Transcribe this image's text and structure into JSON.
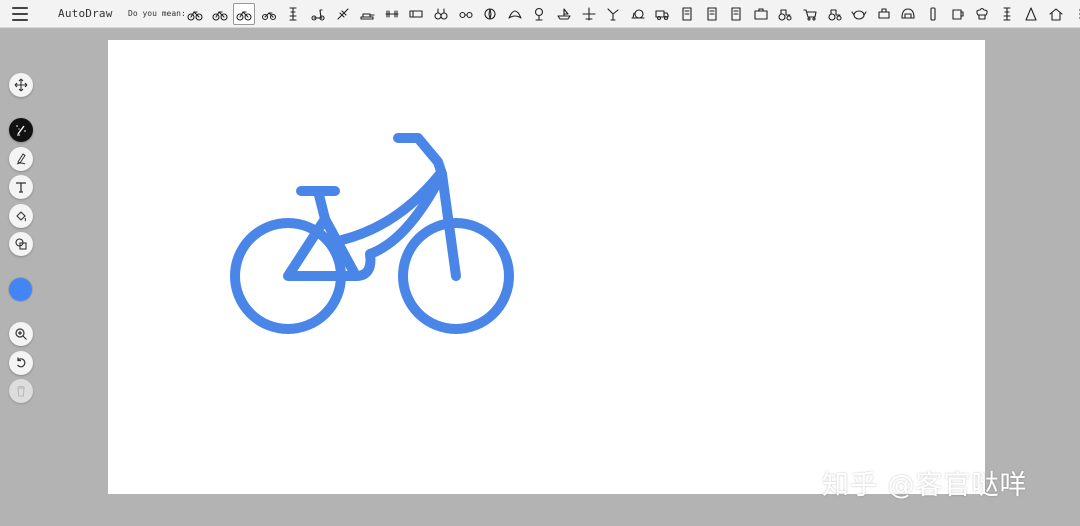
{
  "app": {
    "title": "AutoDraw"
  },
  "toolbar": {
    "suggest_label": "Do you mean:",
    "suggestions": [
      "bicycle-icon",
      "bicycle-icon",
      "bicycle-icon",
      "motorcycle-icon",
      "tower-icon",
      "scooter-icon",
      "satellite-icon",
      "tank-icon",
      "dumbbell-icon",
      "tube-icon",
      "binoculars-icon",
      "glasses-icon",
      "compass-icon",
      "fan-icon",
      "lamp-icon",
      "boat-icon",
      "plane-icon",
      "windmill-icon",
      "snail-icon",
      "truck-icon",
      "book-icon",
      "book-icon",
      "book-icon",
      "suitcase-icon",
      "tractor-icon",
      "cart-icon",
      "tractor-icon",
      "teapot-icon",
      "pot-icon",
      "helmet-icon",
      "bottle-icon",
      "mug-icon",
      "chef-hat-icon",
      "tower-icon",
      "cone-icon",
      "house-icon",
      "dots-icon"
    ],
    "selected_index": 2
  },
  "tools": [
    {
      "name": "move-tool",
      "icon": "move-icon"
    },
    {
      "name": "autodraw-tool",
      "icon": "autodraw-icon",
      "active": true
    },
    {
      "name": "draw-tool",
      "icon": "pen-icon"
    },
    {
      "name": "type-tool",
      "icon": "text-icon"
    },
    {
      "name": "fill-tool",
      "icon": "fill-icon"
    },
    {
      "name": "shape-tool",
      "icon": "shape-icon"
    },
    {
      "name": "zoom-tool",
      "icon": "zoom-icon"
    },
    {
      "name": "undo-tool",
      "icon": "undo-icon"
    },
    {
      "name": "delete-tool",
      "icon": "trash-icon",
      "disabled": true
    }
  ],
  "colors": {
    "current": "#4285f4",
    "stroke": "#4a86e8"
  },
  "watermark": "知乎 @客官哒咩"
}
